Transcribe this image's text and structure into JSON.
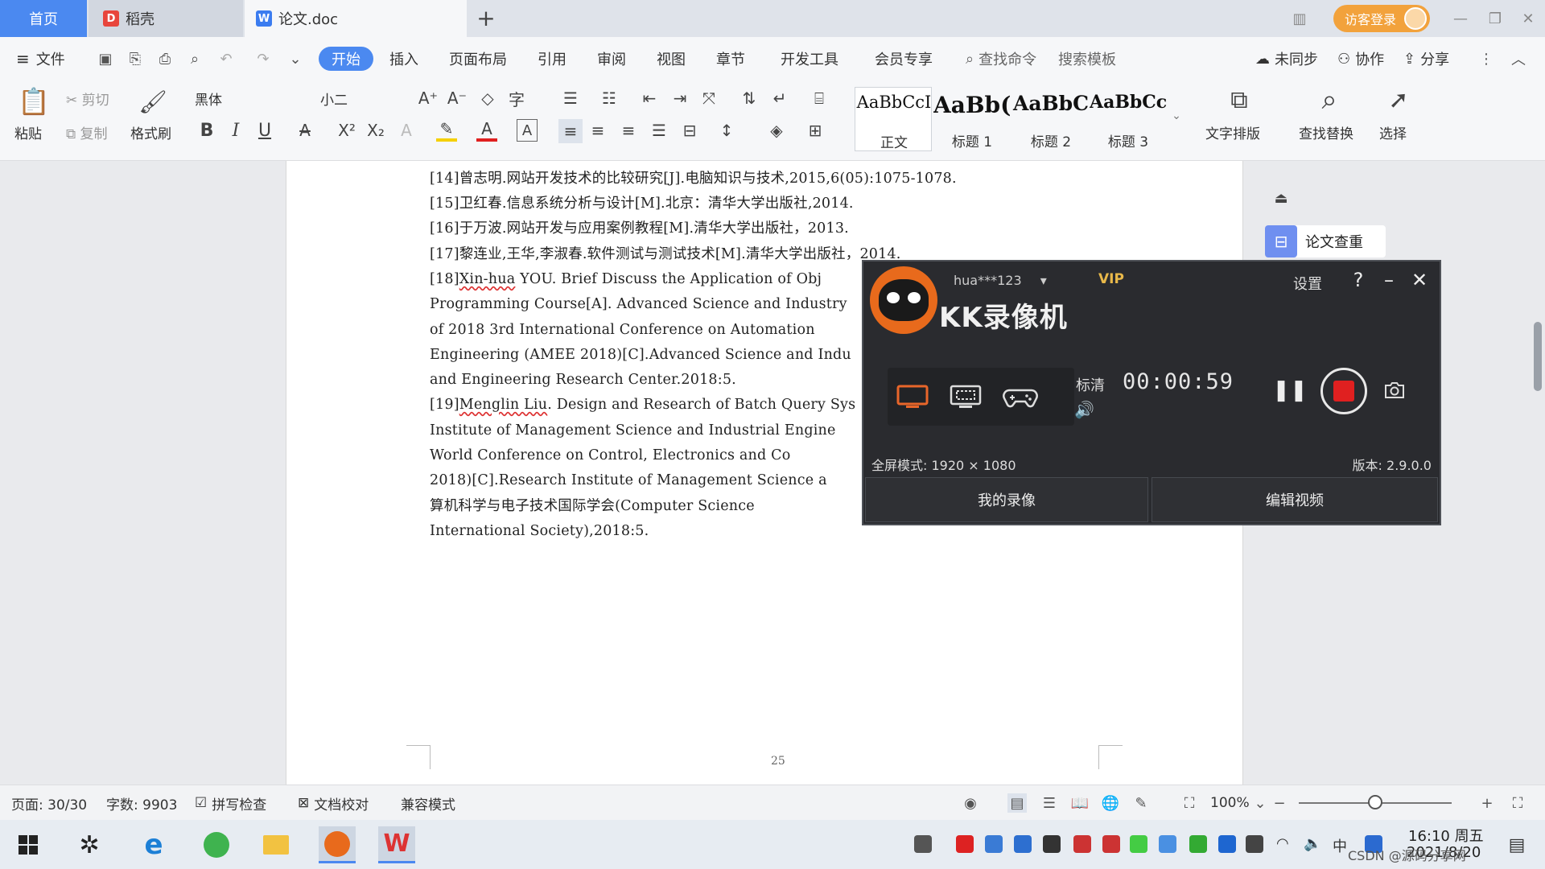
{
  "tabs": {
    "home": "首页",
    "daoke": "稻壳",
    "doc": "论文.doc",
    "add": "+"
  },
  "header": {
    "login": "访客登录"
  },
  "menu": {
    "file": "文件",
    "items": [
      "开始",
      "插入",
      "页面布局",
      "引用",
      "审阅",
      "视图",
      "章节",
      "开发工具",
      "会员专享"
    ],
    "search_cmd": "查找命令",
    "search_tpl": "搜索模板",
    "sync": "未同步",
    "collab": "协作",
    "share": "分享"
  },
  "ribbon": {
    "paste": "粘贴",
    "cut": "剪切",
    "copy": "复制",
    "format_painter": "格式刷",
    "font": "黑体",
    "size": "小二",
    "styles": [
      {
        "preview": "AaBbCcI",
        "name": "正文"
      },
      {
        "preview": "AaBb(",
        "name": "标题 1"
      },
      {
        "preview": "AaBbC",
        "name": "标题 2"
      },
      {
        "preview": "AaBbCcl",
        "name": "标题 3"
      }
    ],
    "text_layout": "文字排版",
    "find_replace": "查找替换",
    "select": "选择"
  },
  "document": {
    "references": [
      "[14]曾志明.网站开发技术的比较研究[J].电脑知识与技术,2015,6(05):1075-1078.",
      "[15]卫红春.信息系统分析与设计[M].北京：清华大学出版社,2014.",
      "[16]于万波.网站开发与应用案例教程[M].清华大学出版社，2013.",
      "[17]黎连业,王华,李淑春.软件测试与测试技术[M].清华大学出版社，2014.",
      "[18]Xin-hua YOU. Brief Discuss the Application of Obj",
      "Programming Course[A]. Advanced Science and Industry",
      "of 2018 3rd International Conference on Automation",
      "Engineering (AMEE 2018)[C].Advanced Science and Indu",
      "and Engineering Research Center.2018:5.",
      "[19]Menglin Liu. Design and Research of Batch Query Sys",
      "Institute of Management Science and Industrial Engine",
      "World Conference on Control, Electronics and Co",
      "2018)[C].Research Institute of Management Science a",
      "算机科学与电子技术国际学会(Computer Science",
      "International Society),2018:5."
    ],
    "page_number": "25"
  },
  "side_panel": {
    "plagiarism_check": "论文查重"
  },
  "recorder": {
    "user": "hua***123",
    "vip": "VIP",
    "settings": "设置",
    "help": "?",
    "title": "KK录像机",
    "quality": "标清",
    "time": "00:00:59",
    "mode_line": "全屏模式: 1920 × 1080",
    "version": "版本: 2.9.0.0",
    "my_recordings": "我的录像",
    "edit_video": "编辑视频"
  },
  "status": {
    "page": "页面: 30/30",
    "words": "字数: 9903",
    "spell": "拼写检查",
    "proof": "文档校对",
    "compat": "兼容模式",
    "zoom": "100%",
    "zoom_level_percent": 50
  },
  "taskbar": {
    "time": "16:10 周五",
    "date": "2021/8/20",
    "watermark": "CSDN @源码分享网"
  },
  "colors": {
    "accent": "#4b89f0",
    "record_red": "#e02020",
    "recorder_bg": "#2a2b2f",
    "login_orange": "#f2a23c"
  }
}
